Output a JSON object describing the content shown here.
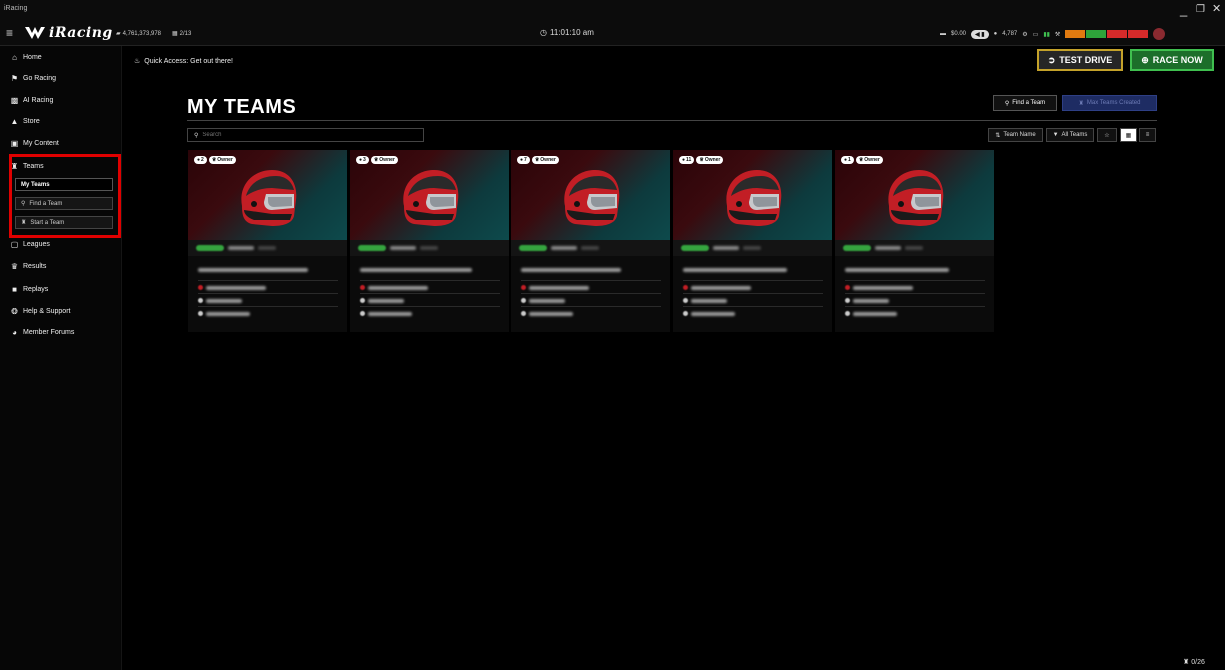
{
  "window": {
    "title": "iRacing",
    "minimize": "_",
    "restore": "❐",
    "close": "✕"
  },
  "topbar": {
    "logo_text": "iRacing",
    "stat_a": "4,761,373,978",
    "stat_b": "2/13",
    "clock": "11:01:10 am",
    "balance": "$0.00",
    "credits": "4,787"
  },
  "sidebar": {
    "home": "Home",
    "go_racing": "Go Racing",
    "ai_racing": "AI Racing",
    "store": "Store",
    "my_content": "My Content",
    "teams": "Teams",
    "my_teams": "My Teams",
    "find_team": "Find a Team",
    "start_team": "Start a Team",
    "leagues": "Leagues",
    "results": "Results",
    "replays": "Replays",
    "help": "Help & Support",
    "forums": "Member Forums"
  },
  "main": {
    "quick_access": "Quick Access: Get out there!",
    "test_drive": "TEST DRIVE",
    "race_now": "RACE NOW",
    "page_title": "MY TEAMS",
    "find_team_btn": "Find a Team",
    "max_teams_btn": "Max Teams Created",
    "search_placeholder": "Search",
    "sort_team_name": "Team Name",
    "filter_all_teams": "All Teams"
  },
  "cards": [
    {
      "members": "2",
      "role": "Owner"
    },
    {
      "members": "3",
      "role": "Owner"
    },
    {
      "members": "7",
      "role": "Owner"
    },
    {
      "members": "11",
      "role": "Owner"
    },
    {
      "members": "1",
      "role": "Owner"
    }
  ],
  "footer": {
    "count": "0/26"
  },
  "colors": {
    "accent_red": "#e00000",
    "race_green": "#1c6e2a",
    "test_gold": "#c4a22a",
    "max_blue": "#1e2c63"
  }
}
